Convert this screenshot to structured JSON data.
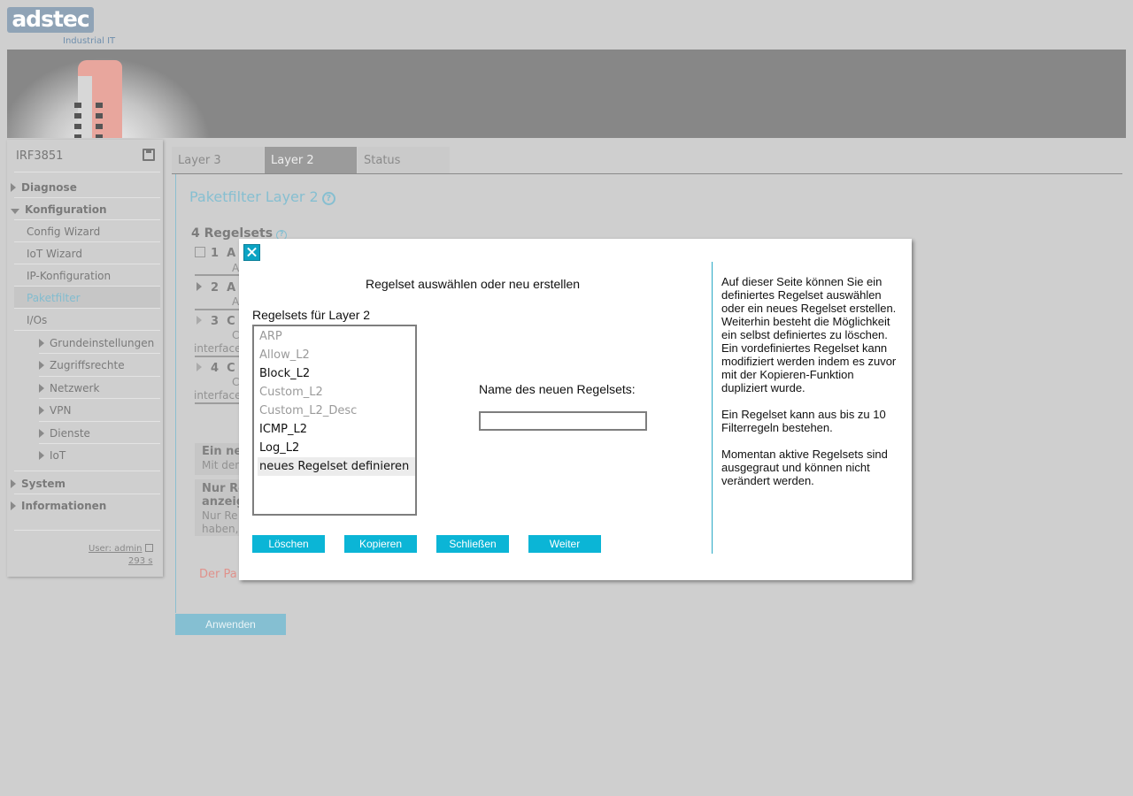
{
  "brand": {
    "logo_text": "adstec",
    "tagline": "Industrial IT"
  },
  "device_name": "IRF3851",
  "nav": {
    "diagnose": "Diagnose",
    "konfiguration": "Konfiguration",
    "config_wizard": "Config Wizard",
    "iot_wizard": "IoT Wizard",
    "ip_konfiguration": "IP-Konfiguration",
    "paketfilter": "Paketfilter",
    "ios": "I/Os",
    "grundeinstellungen": "Grundeinstellungen",
    "zugriffsrechte": "Zugriffsrechte",
    "netzwerk": "Netzwerk",
    "vpn": "VPN",
    "dienste": "Dienste",
    "iot": "IoT",
    "system": "System",
    "informationen": "Informationen"
  },
  "session": {
    "user": "User: admin",
    "timer": "293 s"
  },
  "tabs": [
    "Layer 3",
    "Layer 2",
    "Status"
  ],
  "main": {
    "title": "Paketfilter Layer 2",
    "rulesets_title": "4 Regelsets",
    "rows": [
      {
        "num": "1",
        "name": "A",
        "sub": "A"
      },
      {
        "num": "2",
        "name": "A",
        "sub": "A"
      },
      {
        "num": "3",
        "name": "C",
        "sub": "C",
        "sub2": "interface"
      },
      {
        "num": "4",
        "name": "C",
        "sub": "C",
        "sub2": "interface"
      }
    ],
    "box1_title": "Ein ne",
    "box1_sub": "Mit den",
    "box2_title1": "Nur Re",
    "box2_title2": "anzeig",
    "box2_sub1": "Nur Re",
    "box2_sub2": "haben,",
    "warning": "Der Pa",
    "apply_label": "Anwenden"
  },
  "modal": {
    "title": "Regelset auswählen oder neu erstellen",
    "list_label": "Regelsets für Layer 2",
    "options": [
      {
        "label": "ARP",
        "disabled": true
      },
      {
        "label": "Allow_L2",
        "disabled": true
      },
      {
        "label": "Block_L2",
        "disabled": false
      },
      {
        "label": "Custom_L2",
        "disabled": true
      },
      {
        "label": "Custom_L2_Desc",
        "disabled": true
      },
      {
        "label": "ICMP_L2",
        "disabled": false
      },
      {
        "label": "Log_L2",
        "disabled": false
      },
      {
        "label": "neues Regelset definieren",
        "disabled": false,
        "selected": true
      }
    ],
    "name_label": "Name des neuen Regelsets:",
    "name_value": "",
    "buttons": {
      "delete": "Löschen",
      "copy": "Kopieren",
      "close": "Schließen",
      "next": "Weiter"
    },
    "help_p1": "Auf dieser Seite können Sie ein definiertes Regelset auswählen oder ein neues Regelset erstellen. Weiterhin besteht die Möglichkeit ein selbst definiertes zu löschen. Ein vordefiniertes Regelset kann modifiziert werden indem es zuvor mit der Kopieren-Funktion dupliziert wurde.",
    "help_p2": "Ein Regelset kann aus bis zu 10 Filterregeln bestehen.",
    "help_p3": "Momentan aktive Regelsets sind ausgegraut und können nicht verändert werden."
  },
  "colors": {
    "accent": "#0bb5d6",
    "muted_accent": "#86bfd1",
    "warning": "#e0928c"
  }
}
